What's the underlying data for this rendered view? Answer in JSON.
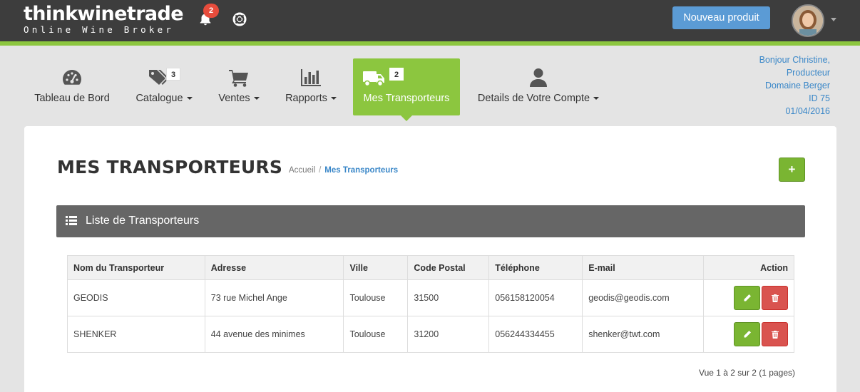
{
  "brand": {
    "name": "thinkwinetrade",
    "tagline": "Online Wine Broker"
  },
  "notifications": {
    "count": "2"
  },
  "topbar": {
    "new_product_label": "Nouveau produit"
  },
  "nav": {
    "items": [
      {
        "label": "Tableau de Bord",
        "icon": "dashboard-icon"
      },
      {
        "label": "Catalogue",
        "icon": "tags-icon",
        "count": "3"
      },
      {
        "label": "Ventes",
        "icon": "cart-icon"
      },
      {
        "label": "Rapports",
        "icon": "bar-chart-icon"
      },
      {
        "label": "Mes Transporteurs",
        "icon": "truck-icon",
        "count": "2",
        "active": true
      },
      {
        "label": "Details de Votre Compte",
        "icon": "user-icon"
      }
    ]
  },
  "greeting": {
    "line1": "Bonjour Christine,",
    "line2": "Producteur",
    "line3": "Domaine Berger",
    "line4": "ID 75",
    "line5": "01/04/2016"
  },
  "page": {
    "title": "MES TRANSPORTEURS",
    "breadcrumb_home": "Accueil",
    "breadcrumb_sep": "/",
    "breadcrumb_current": "Mes Transporteurs",
    "add_label": "+"
  },
  "list": {
    "title": "Liste de Transporteurs",
    "columns": [
      "Nom du Transporteur",
      "Adresse",
      "Ville",
      "Code Postal",
      "Téléphone",
      "E-mail",
      "Action"
    ],
    "rows": [
      {
        "name": "GEODIS",
        "address": "73 rue Michel Ange",
        "city": "Toulouse",
        "postal": "31500",
        "phone": "056158120054",
        "email": "geodis@geodis.com"
      },
      {
        "name": "SHENKER",
        "address": "44 avenue des minimes",
        "city": "Toulouse",
        "postal": "31200",
        "phone": "056244334455",
        "email": "shenker@twt.com"
      }
    ],
    "pagination": "Vue 1 à 2 sur 2 (1 pages)"
  },
  "colors": {
    "accent_green": "#8cc63f",
    "topbar": "#3d3d3d",
    "primary_blue": "#5b9bd5",
    "danger": "#d9534f"
  }
}
